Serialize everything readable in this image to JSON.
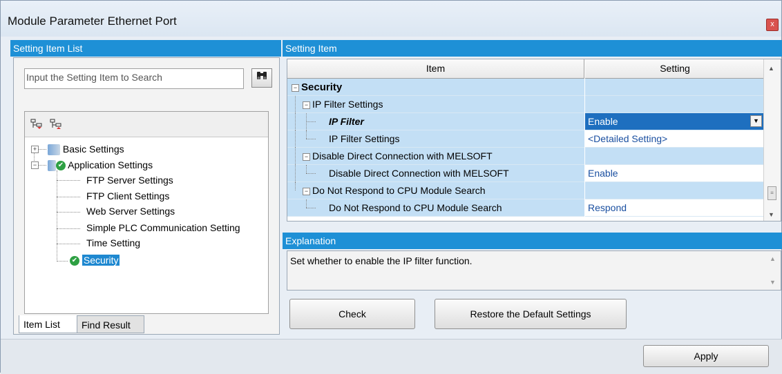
{
  "window": {
    "title": "Module Parameter Ethernet Port",
    "close_glyph": "x"
  },
  "left": {
    "header": "Setting Item List",
    "search_placeholder": "Input the Setting Item to Search",
    "tree": {
      "basic": "Basic Settings",
      "application": "Application Settings",
      "children": [
        "FTP Server Settings",
        "FTP Client Settings",
        "Web Server Settings",
        "Simple PLC Communication Setting",
        "Time Setting",
        "Security"
      ]
    },
    "tabs": [
      "Item List",
      "Find Result"
    ]
  },
  "right": {
    "header": "Setting Item",
    "columns": {
      "item": "Item",
      "setting": "Setting"
    },
    "rows": [
      {
        "label": "Security",
        "setting": ""
      },
      {
        "label": "IP Filter Settings",
        "setting": ""
      },
      {
        "label": "IP Filter",
        "setting": "Enable"
      },
      {
        "label": "IP Filter Settings",
        "setting": "<Detailed Setting>"
      },
      {
        "label": "Disable Direct Connection with MELSOFT",
        "setting": ""
      },
      {
        "label": "Disable Direct Connection with MELSOFT",
        "setting": "Enable"
      },
      {
        "label": "Do Not Respond to CPU Module Search",
        "setting": ""
      },
      {
        "label": "Do Not Respond to CPU Module Search",
        "setting": "Respond"
      }
    ],
    "explanation_header": "Explanation",
    "explanation_text": "Set whether to enable the IP filter function.",
    "buttons": {
      "check": "Check",
      "restore": "Restore the Default Settings"
    }
  },
  "footer": {
    "apply": "Apply"
  },
  "colors": {
    "header_blue": "#1e90d6",
    "row_blue": "#c3dff5",
    "selected": "#1e6fbf"
  }
}
